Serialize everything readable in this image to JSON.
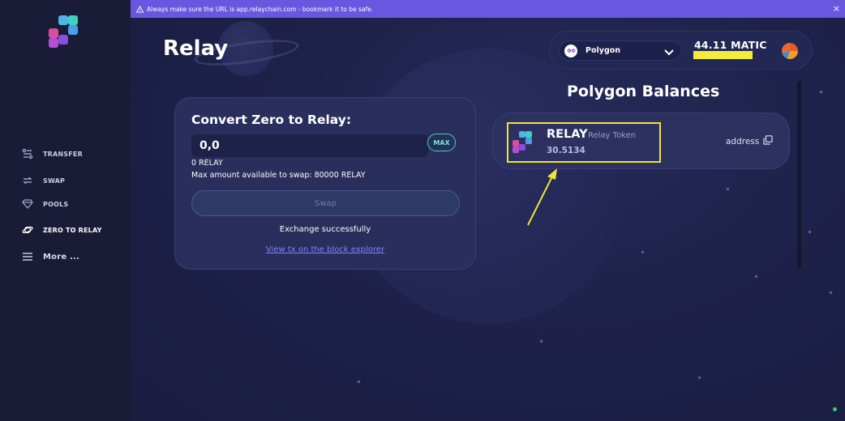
{
  "banner": {
    "text": "Always make sure the URL is app.relaychain.com - bookmark it to be safe.",
    "close": "×"
  },
  "sidebar": {
    "items": [
      {
        "label": "TRANSFER",
        "icon": "transfer-icon"
      },
      {
        "label": "SWAP",
        "icon": "swap-icon"
      },
      {
        "label": "POOLS",
        "icon": "diamond-icon"
      },
      {
        "label": "ZERO TO RELAY",
        "icon": "planet-icon"
      },
      {
        "label": "More ...",
        "icon": "menu-icon"
      }
    ]
  },
  "page": {
    "title": "Relay"
  },
  "header": {
    "network": "Polygon",
    "balance": "44.11 MATIC"
  },
  "convert": {
    "title": "Convert Zero to Relay:",
    "amount": "0,0",
    "max_label": "MAX",
    "relay_balance": "0 RELAY",
    "max_available": "Max amount available to swap: 80000 RELAY",
    "swap_label": "Swap",
    "status": "Exchange successfully",
    "explorer_link": "View tx on the block explorer"
  },
  "balances": {
    "title": "Polygon Balances",
    "tokens": [
      {
        "symbol": "RELAY",
        "name": "Relay Token",
        "amount": "30.5134",
        "address_label": "address"
      }
    ]
  },
  "colors": {
    "background": "#1c1f45",
    "sidebar": "#1a1b37",
    "banner": "#6a57e0",
    "highlight": "#f0e33a",
    "link": "#7c86ff",
    "max_border": "#59c7c4"
  }
}
